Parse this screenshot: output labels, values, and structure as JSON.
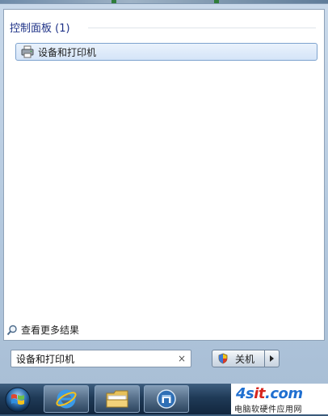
{
  "results": {
    "group_header": "控制面板 (1)",
    "items": [
      {
        "label": "设备和打印机",
        "icon": "printer-icon"
      }
    ],
    "see_more": "查看更多结果"
  },
  "search": {
    "value": "设备和打印机",
    "clear_glyph": "×"
  },
  "shutdown": {
    "label": "关机",
    "icon": "shield-icon"
  },
  "taskbar": {
    "items": [
      {
        "name": "start-orb",
        "icon": "windows-logo-icon"
      },
      {
        "name": "internet-explorer",
        "icon": "ie-icon"
      },
      {
        "name": "windows-explorer",
        "icon": "folder-icon"
      },
      {
        "name": "app-window",
        "icon": "window-icon"
      }
    ]
  },
  "watermark": {
    "logo_left": "4s",
    "logo_mid": "it",
    "logo_right": ".com",
    "subtitle": "电脑软硬件应用网"
  },
  "colors": {
    "group_header": "#1e3287",
    "selection_border": "#7da2ce",
    "taskbar": "#1f3a57",
    "logo_blue": "#1f6fd0",
    "logo_red": "#d6261e"
  }
}
